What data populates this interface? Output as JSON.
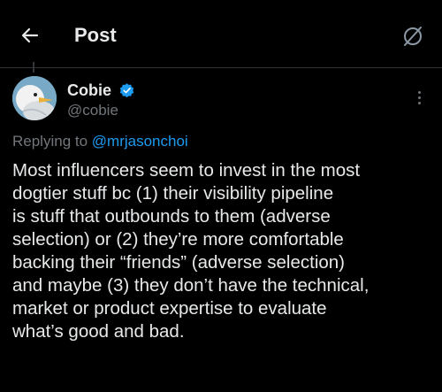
{
  "header": {
    "back_icon": "arrow-left-icon",
    "title": "Post",
    "rules_icon": "circle-slash-icon"
  },
  "author": {
    "name": "Cobie",
    "handle": "@cobie",
    "verified_icon": "verified-badge-icon",
    "verified_color": "#1d9bf0",
    "avatar_icon": "seagull-avatar"
  },
  "more_icon": "more-vertical-icon",
  "reply": {
    "prefix": "Replying to ",
    "handle": "@mrjasonchoi"
  },
  "tweet": {
    "text": "Most influencers seem to invest in the most\ndogtier stuff bc (1) their visibility pipeline\nis stuff that outbounds to them (adverse\nselection) or (2) they’re more comfortable\nbacking their “friends” (adverse selection)\nand maybe (3) they don’t have the technical,\nmarket or product expertise to evaluate\nwhat’s good and bad."
  },
  "colors": {
    "background": "#000000",
    "text": "#e7e9ea",
    "secondary": "#71767b",
    "accent": "#1d9bf0"
  }
}
